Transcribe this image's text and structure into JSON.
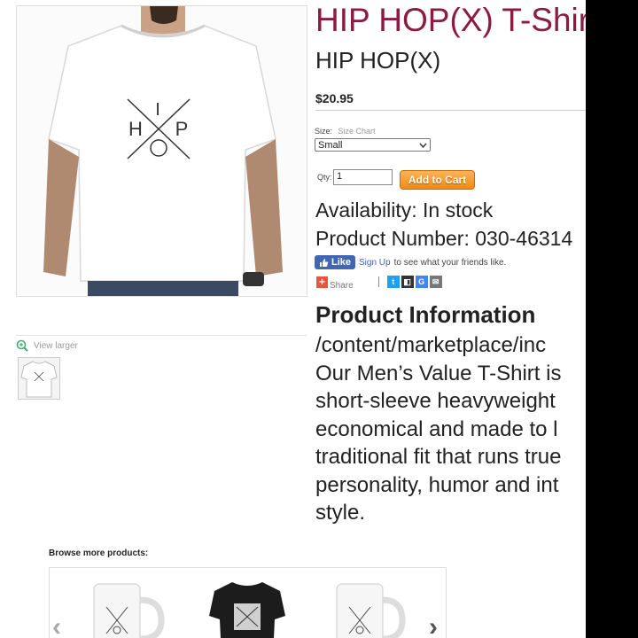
{
  "product": {
    "title": "HIP HOP(X) T-Shirt",
    "subtitle": "HIP HOP(X)",
    "price": "$20.95",
    "design_letters": {
      "top": "I",
      "left": "H",
      "right": "P",
      "bottom": "O"
    }
  },
  "gallery": {
    "view_larger": "View larger"
  },
  "options": {
    "size_label": "Size:",
    "size_chart_link": "Size Chart",
    "size_selected": "Small",
    "qty_label": "Qty:",
    "qty_value": "1",
    "add_to_cart": "Add to Cart"
  },
  "stock": {
    "availability": "Availability: In stock",
    "product_number": "Product Number: 030-46314"
  },
  "social": {
    "like": "Like",
    "sign_up": "Sign Up",
    "sign_up_suffix": "to see what your friends like.",
    "share": "Share"
  },
  "info": {
    "heading": "Product Information",
    "lines": [
      "/content/marketplace/inc",
      "Our Men’s Value T-Shirt is",
      "short-sleeve heavyweight",
      "economical and made to l",
      "traditional fit that runs true",
      "personality, humor and int",
      "style."
    ]
  },
  "browse": {
    "label": "Browse more products:"
  },
  "colors": {
    "title": "#8c1a41",
    "cart_button": "#f08a12",
    "facebook": "#4267b2"
  }
}
